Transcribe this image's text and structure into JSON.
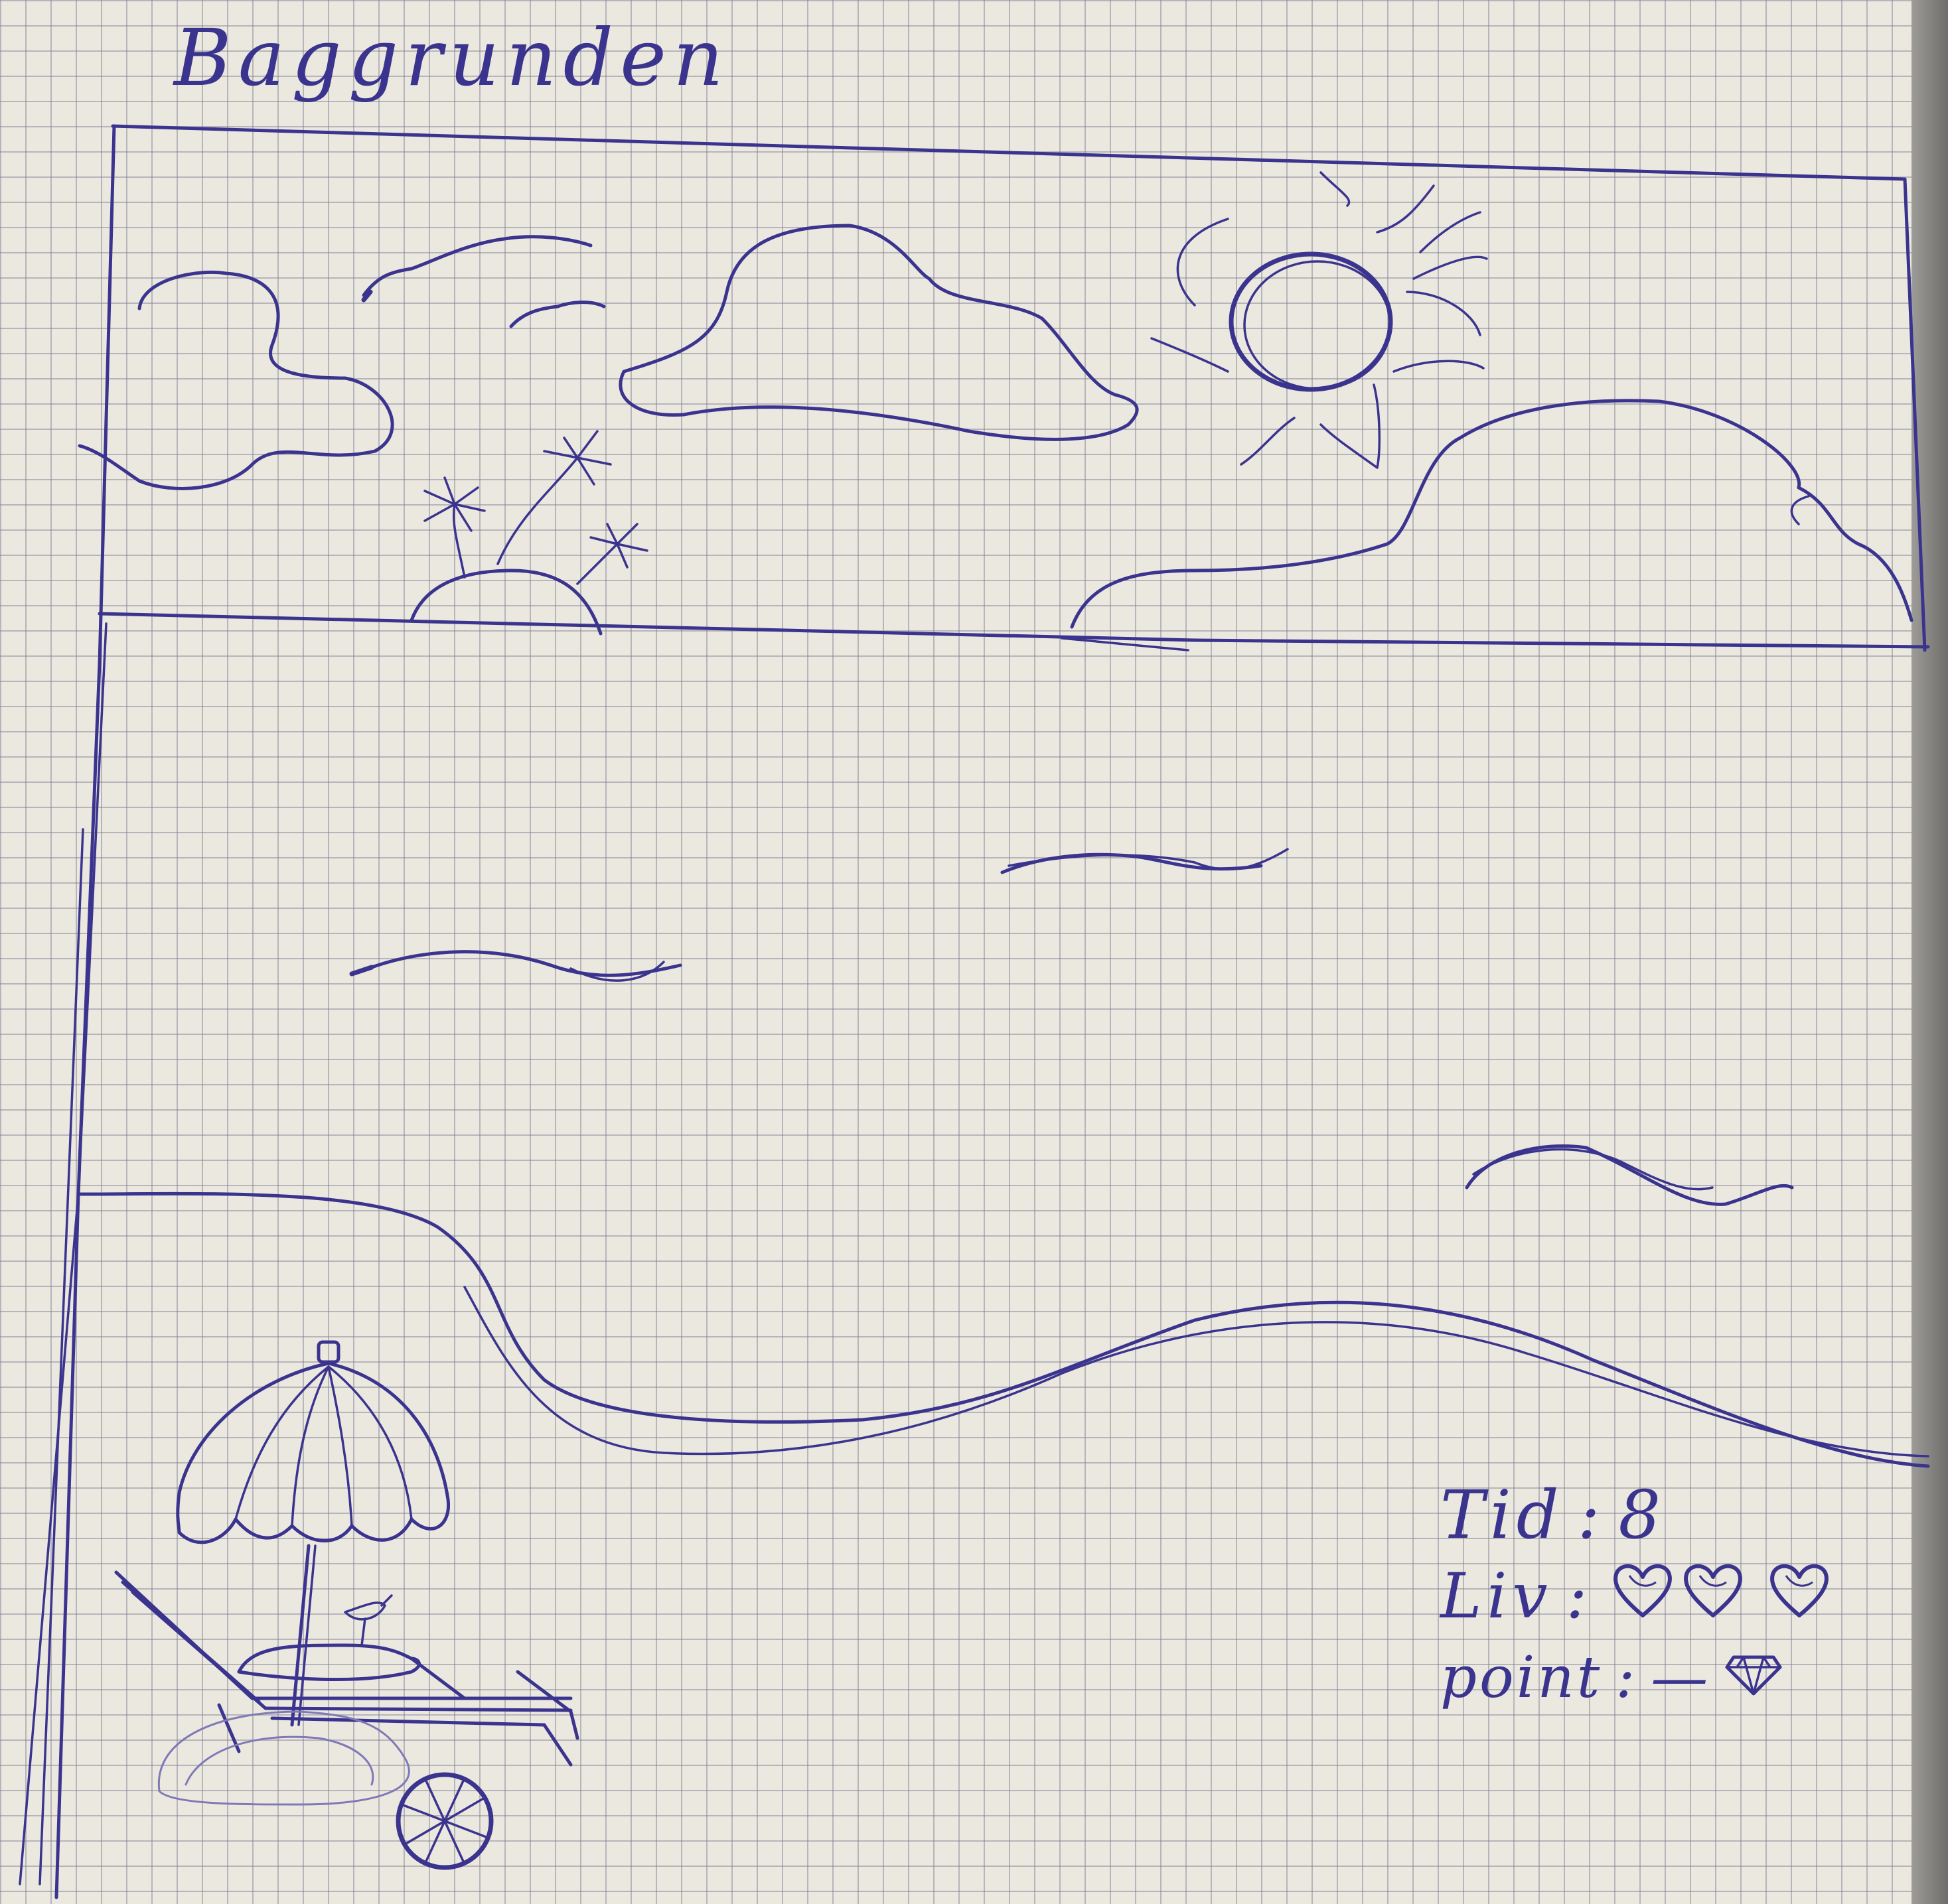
{
  "title": "Baggrunden",
  "hud": {
    "time_label": "Tid",
    "time_value": "8",
    "lives_label": "Liv",
    "lives_count": 3,
    "points_label": "point",
    "points_value": "—"
  },
  "colors": {
    "paper": "#ebe8e0",
    "grid": "#8c8ca4",
    "ink": "#3b348e"
  },
  "icons": [
    "sun-icon",
    "cloud-icon",
    "bird-icon",
    "palm-island-icon",
    "wave-icon",
    "beach-umbrella-icon",
    "deck-chair-icon",
    "beach-ball-icon",
    "drink-glass-icon",
    "heart-icon",
    "diamond-icon"
  ]
}
